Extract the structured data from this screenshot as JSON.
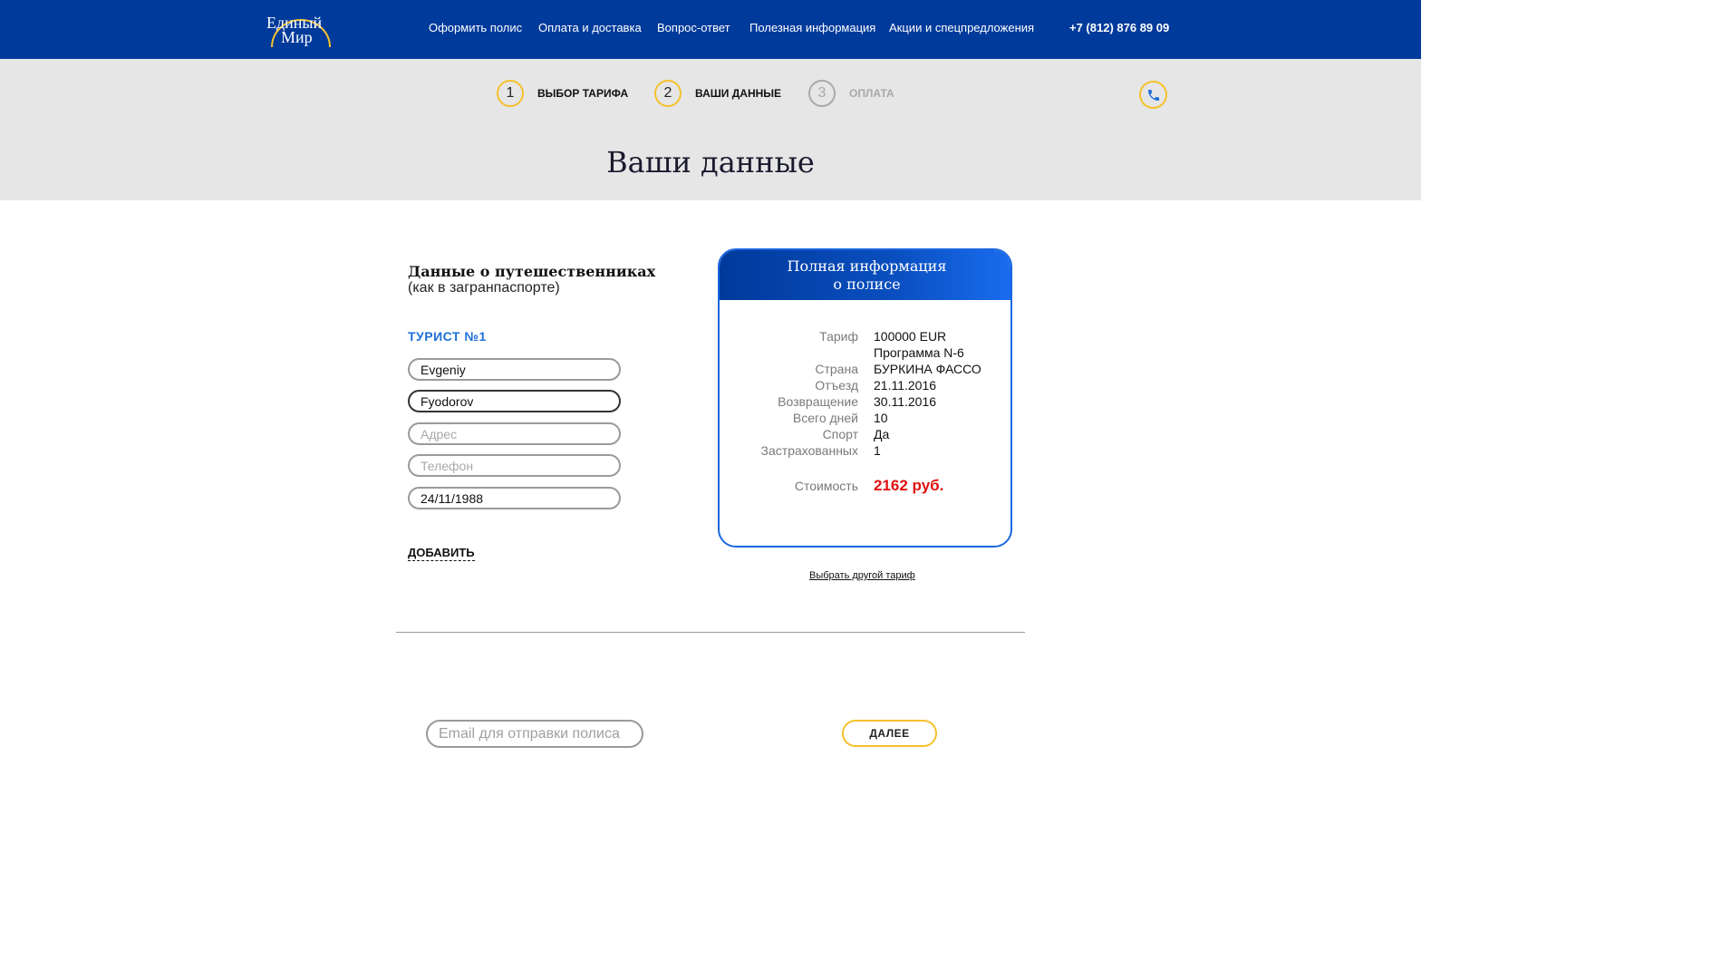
{
  "header": {
    "logo_line1": "Единый",
    "logo_line2": "Мир",
    "nav": [
      "Оформить полис",
      "Оплата и доставка",
      "Вопрос-ответ",
      "Полезная информация",
      "Акции и спецпредложения"
    ],
    "phone": "+7 (812) 876 89 09"
  },
  "steps": [
    {
      "num": "1",
      "label": "ВЫБОР ТАРИФА"
    },
    {
      "num": "2",
      "label": "ВАШИ ДАННЫЕ"
    },
    {
      "num": "3",
      "label": "ОПЛАТА"
    }
  ],
  "page_title": "Ваши данные",
  "form": {
    "title": "Данные о путешественниках",
    "subtitle": "(как в загранпаспорте)",
    "tourist_label": "ТУРИСТ №1",
    "first_name": "Evgeniy",
    "last_name": "Fyodorov",
    "address_placeholder": "Адрес",
    "phone_placeholder": "Телефон",
    "birth_date": "24/11/1988",
    "add_label": "ДОБАВИТЬ"
  },
  "policy": {
    "title_line1": "Полная информация",
    "title_line2": "о полисе",
    "rows": [
      {
        "key": "Тариф",
        "value": "100000 EUR"
      },
      {
        "key": "",
        "value": "Программа N-6"
      },
      {
        "key": "Страна",
        "value": "БУРКИНА ФАССО"
      },
      {
        "key": "Отъезд",
        "value": "21.11.2016"
      },
      {
        "key": "Возвращение",
        "value": "30.11.2016"
      },
      {
        "key": "Всего дней",
        "value": "10"
      },
      {
        "key": "Спорт",
        "value": "Да"
      },
      {
        "key": "Застрахованных",
        "value": "1"
      }
    ],
    "price_key": "Стоимость",
    "price_value": "2162 руб.",
    "other_tariff": "Выбрать другой тариф"
  },
  "footer": {
    "email_placeholder": "Email для отправки полиса",
    "next_label": "ДАЛЕЕ"
  },
  "colors": {
    "header_bg": "#003a9b",
    "accent_yellow": "#f5c12b",
    "accent_blue": "#1e6fd9",
    "price_red": "#e01010",
    "band_bg": "#e6e6e7"
  }
}
